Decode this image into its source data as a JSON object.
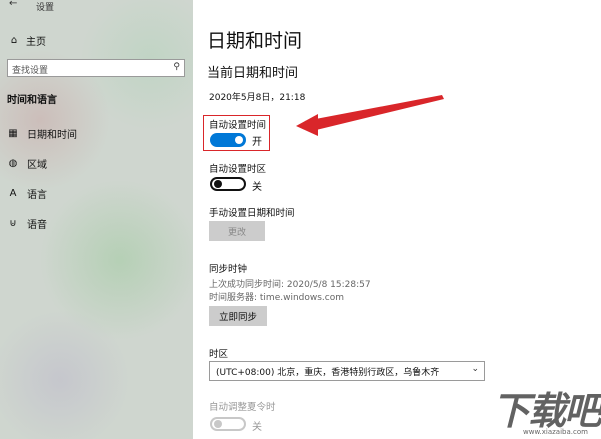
{
  "window": {
    "title": "设置"
  },
  "sidebar": {
    "home_label": "主页",
    "search_placeholder": "查找设置",
    "section_title": "时间和语言",
    "items": [
      {
        "label": "日期和时间",
        "icon": "calendar-icon"
      },
      {
        "label": "区域",
        "icon": "region-icon"
      },
      {
        "label": "语言",
        "icon": "language-icon"
      },
      {
        "label": "语音",
        "icon": "microphone-icon"
      }
    ]
  },
  "main": {
    "title": "日期和时间",
    "subtitle": "当前日期和时间",
    "current_datetime": "2020年5月8日，21:18",
    "auto_time": {
      "label": "自动设置时间",
      "state": "开"
    },
    "auto_timezone": {
      "label": "自动设置时区",
      "state": "关"
    },
    "manual": {
      "label": "手动设置日期和时间",
      "button": "更改"
    },
    "sync": {
      "title": "同步时钟",
      "last_sync": "上次成功同步时间: 2020/5/8 15:28:57",
      "server": "时间服务器: time.windows.com",
      "button": "立即同步"
    },
    "timezone": {
      "label": "时区",
      "value": "(UTC+08:00) 北京，重庆，香港特别行政区，乌鲁木齐"
    },
    "dst": {
      "label": "自动调整夏令时",
      "state": "关"
    }
  },
  "annotation_color": "#d9262a",
  "accent_color": "#0078d7",
  "watermark": {
    "text": "下载吧",
    "sub": "www.xiazaiba.com"
  }
}
